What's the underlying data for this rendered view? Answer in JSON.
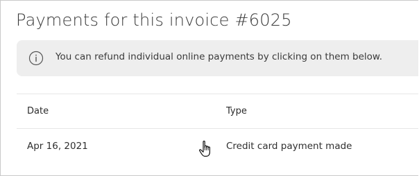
{
  "page": {
    "title": "Payments for this invoice #6025"
  },
  "notice": {
    "icon": "info-icon",
    "text": "You can refund individual online payments by clicking on them below."
  },
  "table": {
    "columns": [
      "Date",
      "Type"
    ],
    "rows": [
      {
        "date": "Apr 16, 2021",
        "type": "Credit card payment made"
      }
    ]
  },
  "cursor": {
    "icon": "hand-pointer-icon"
  }
}
